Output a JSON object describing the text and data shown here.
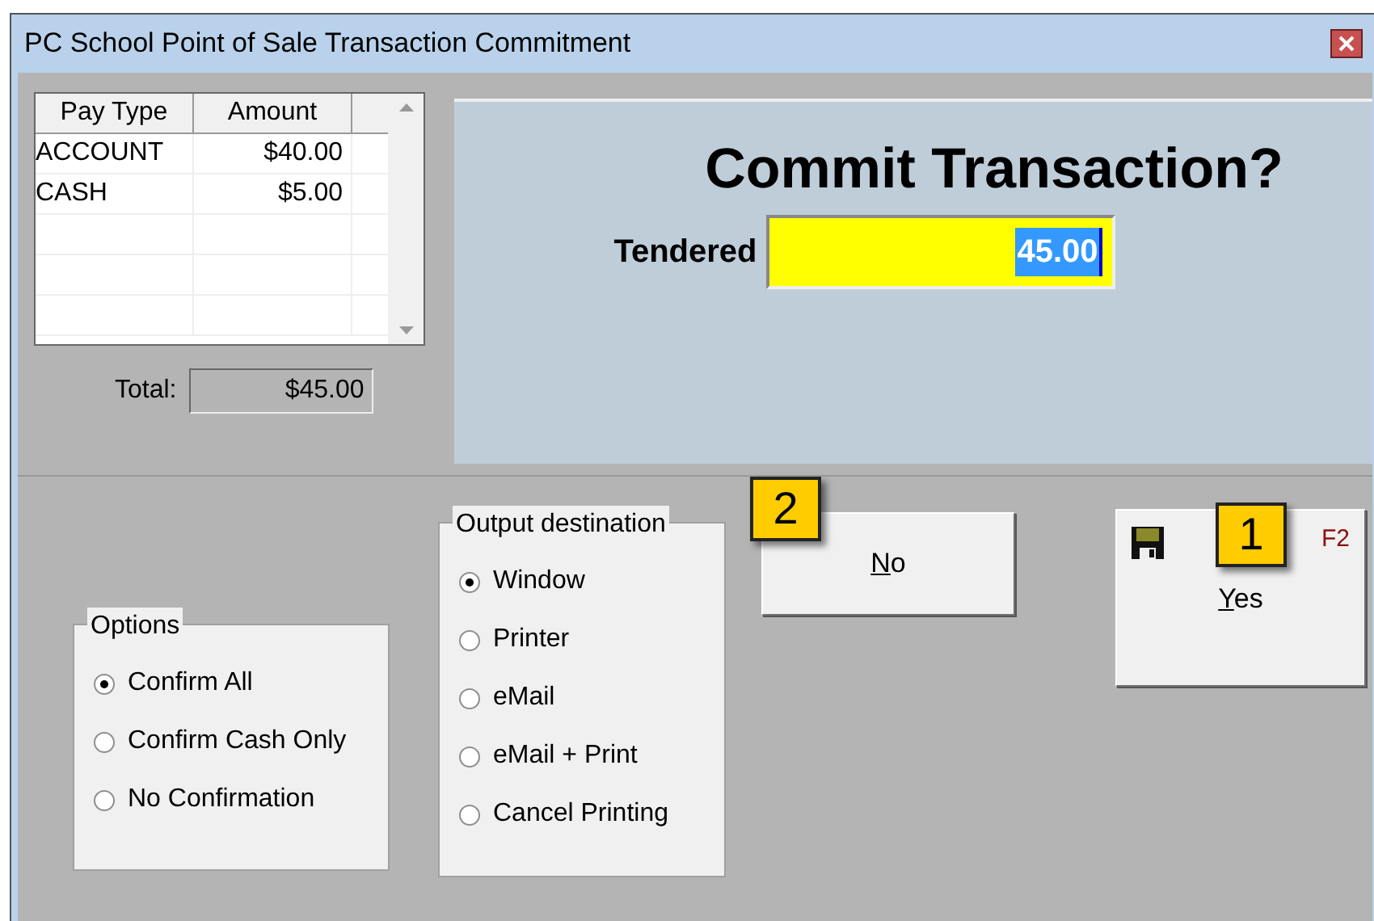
{
  "window": {
    "title": "PC School Point of Sale Transaction Commitment"
  },
  "payments": {
    "columns": [
      "Pay Type",
      "Amount"
    ],
    "rows": [
      {
        "pay_type": "ACCOUNT",
        "amount": "$40.00"
      },
      {
        "pay_type": "CASH",
        "amount": "$5.00"
      }
    ]
  },
  "total": {
    "label": "Total:",
    "value": "$45.00"
  },
  "prompt": {
    "heading": "Commit Transaction?",
    "tendered_label": "Tendered",
    "tendered_value": "45.00"
  },
  "options": {
    "title": "Options",
    "items": [
      {
        "label": "Confirm All",
        "selected": true
      },
      {
        "label": "Confirm Cash Only",
        "selected": false
      },
      {
        "label": "No Confirmation",
        "selected": false
      }
    ]
  },
  "output": {
    "title": "Output destination",
    "items": [
      {
        "label": "Window",
        "selected": true
      },
      {
        "label": "Printer",
        "selected": false
      },
      {
        "label": "eMail",
        "selected": false
      },
      {
        "label": "eMail + Print",
        "selected": false
      },
      {
        "label": "Cancel Printing",
        "selected": false
      }
    ]
  },
  "buttons": [
    {
      "kind": "no",
      "label": "No",
      "underline_first": true,
      "badge": "2"
    },
    {
      "kind": "yes",
      "label": "Yes",
      "underline_first": true,
      "badge": "1",
      "shortcut": "F2"
    }
  ]
}
